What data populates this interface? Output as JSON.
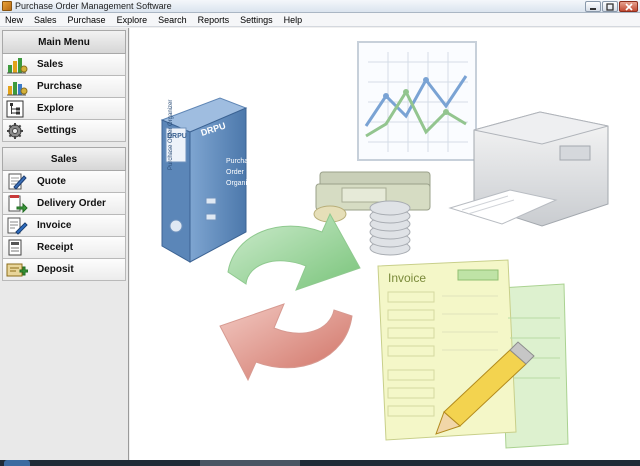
{
  "window": {
    "title": "Purchase Order Management Software"
  },
  "menubar": {
    "items": [
      "New",
      "Sales",
      "Purchase",
      "Explore",
      "Search",
      "Reports",
      "Settings",
      "Help"
    ]
  },
  "sidebar": {
    "main_header": "Main Menu",
    "main_items": [
      {
        "label": "Sales",
        "icon": "sales-chart-icon"
      },
      {
        "label": "Purchase",
        "icon": "purchase-chart-icon"
      },
      {
        "label": "Explore",
        "icon": "explore-tree-icon"
      },
      {
        "label": "Settings",
        "icon": "gear-icon"
      }
    ],
    "sales_header": "Sales",
    "sales_items": [
      {
        "label": "Quote",
        "icon": "quote-icon"
      },
      {
        "label": "Delivery Order",
        "icon": "delivery-order-icon"
      },
      {
        "label": "Invoice",
        "icon": "invoice-icon"
      },
      {
        "label": "Receipt",
        "icon": "receipt-icon"
      },
      {
        "label": "Deposit",
        "icon": "deposit-icon"
      }
    ]
  },
  "illustration": {
    "binder_brand": "DRPU",
    "binder_spine": "Purchase Order Organizer",
    "binder_cover": [
      "Purchase",
      "Order",
      "Organizer"
    ],
    "invoice_title": "Invoice"
  },
  "colors": {
    "accent_green": "#4caf50",
    "accent_red": "#d9534f",
    "binder_blue": "#5b86b8"
  }
}
